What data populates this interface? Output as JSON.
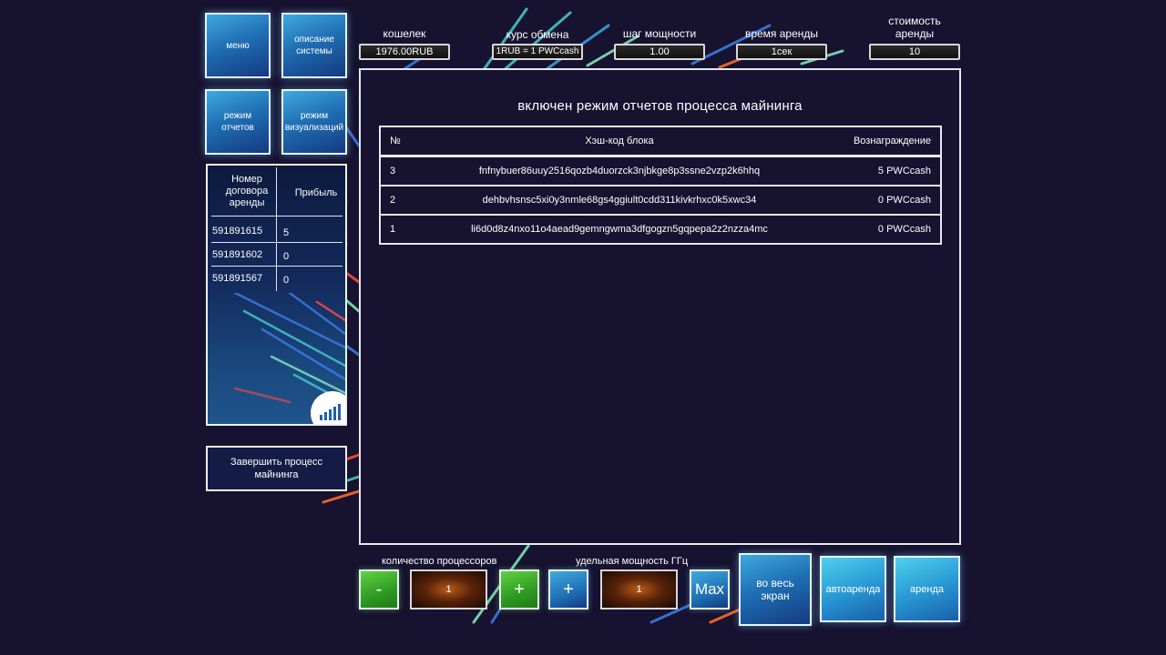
{
  "nav": {
    "menu": "меню",
    "system_description": "описание системы",
    "reports_mode": "режим отчетов",
    "visualization_mode": "режим визуализаций"
  },
  "stats": {
    "wallet": {
      "label": "кошелек",
      "value": "1976.00RUB"
    },
    "exchange_rate": {
      "label": "курс обмена",
      "value": "1RUB = 1 PWCcash"
    },
    "power_step": {
      "label": "шаг мощности",
      "value": "1.00"
    },
    "rent_time": {
      "label": "время аренды",
      "value": "1сек"
    },
    "rent_cost": {
      "label": "стоимость аренды",
      "value": "10"
    }
  },
  "contracts": {
    "col_contract": "Номер договора аренды",
    "col_profit": "Прибыль",
    "rows": [
      {
        "id": "591891615",
        "profit": "5"
      },
      {
        "id": "591891602",
        "profit": "0"
      },
      {
        "id": "591891567",
        "profit": "0"
      }
    ]
  },
  "finish_button": "Завершить процесс майнинга",
  "main": {
    "title": "включен режим отчетов процесса майнинга",
    "table": {
      "headers": {
        "num": "№",
        "hash": "Хэш-код блока",
        "reward": "Вознаграждение"
      },
      "rows": [
        {
          "num": "3",
          "hash": "fnfnybuer86uuy2516qozb4duorzck3njbkge8p3ssne2vzp2k6hhq",
          "reward": "5 PWCcash"
        },
        {
          "num": "2",
          "hash": "dehbvhsnsc5xi0y3nmle68gs4ggiult0cdd311kivkrhxc0k5xwc34",
          "reward": "0 PWCcash"
        },
        {
          "num": "1",
          "hash": "li6d0d8z4nxo11o4aead9gemngwma3dfgogzn5gqpepa2z2nzza4mc",
          "reward": "0 PWCcash"
        }
      ]
    }
  },
  "controls": {
    "processors_label": "количество процессоров",
    "processors_value": "1",
    "power_label": "удельная мощность ГГц",
    "power_value": "1",
    "minus": "-",
    "plus": "+",
    "max": "Max",
    "fullscreen": "во весь экран",
    "auto_rent": "автоаренда",
    "rent": "аренда"
  },
  "colors": {
    "background": "#16122f",
    "tile_blue": "#1f6fb4",
    "tile_cyan": "#2694d2",
    "button_green": "#2f9a22",
    "value_orange": "#b95c1a"
  }
}
